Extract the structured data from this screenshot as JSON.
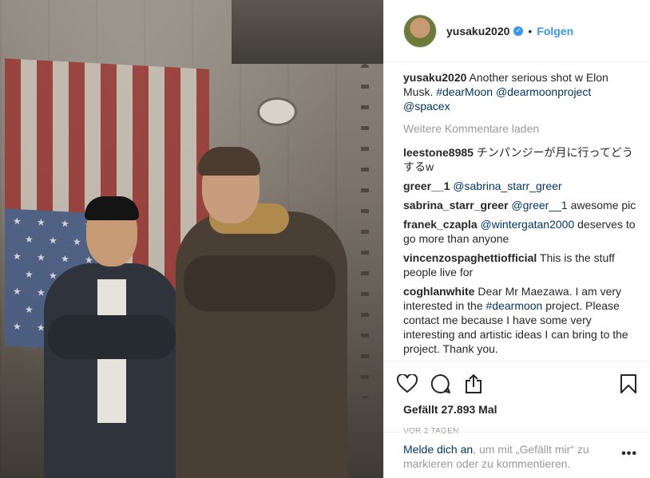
{
  "post": {
    "username": "yusaku2020",
    "verified_symbol": "✓",
    "separator": "•",
    "follow_label": "Folgen"
  },
  "caption": {
    "user": "yusaku2020",
    "text": "Another serious shot w Elon Musk.",
    "tags": [
      "#dearMoon",
      "@dearmoonproject",
      "@spacex"
    ]
  },
  "load_more_label": "Weitere Kommentare laden",
  "comments": [
    {
      "user": "leestone8985",
      "text": "チンパンジーが月に行ってどうするw"
    },
    {
      "user": "greer__1",
      "mention": "@sabrina_starr_greer",
      "text": ""
    },
    {
      "user": "sabrina_starr_greer",
      "mention": "@greer__1",
      "text": "awesome pic"
    },
    {
      "user": "franek_czapla",
      "mention": "@wintergatan2000",
      "text": "deserves to go more than anyone"
    },
    {
      "user": "vincenzospaghettiofficial",
      "text": "This is the stuff people live for"
    },
    {
      "user": "coghlanwhite",
      "text_before": "Dear Mr Maezawa. I am very interested in the",
      "mention": "#dearmoon",
      "text": "project. Please contact me because I have some very interesting and artistic ideas I can bring to the project. Thank you."
    }
  ],
  "likes_label": "Gefällt 27.893 Mal",
  "timestamp": "VOR 2 TAGEN",
  "login": {
    "link": "Melde dich an",
    "text": ", um mit „Gefällt mir“ zu markieren oder zu kommentieren."
  },
  "more_options": "•••"
}
